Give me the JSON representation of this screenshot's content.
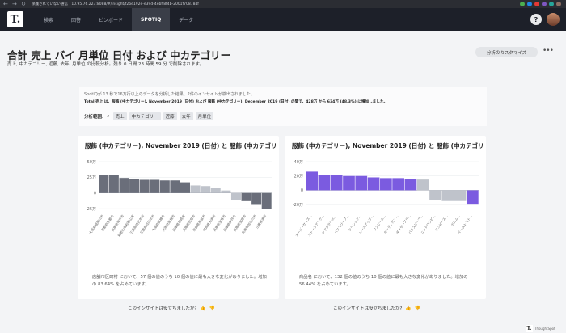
{
  "browser": {
    "warning": "保護されていない通信",
    "url": "10.95.76.223:8088/#/insight/f2be192e-e39d-4ebf-8f4b-2001f708784f"
  },
  "appbar": {
    "logo": "T.",
    "tabs": [
      {
        "label": "検索",
        "active": false
      },
      {
        "label": "回答",
        "active": false
      },
      {
        "label": "ピンボード",
        "active": false
      },
      {
        "label": "SPOTIQ",
        "active": true
      },
      {
        "label": "データ",
        "active": false
      }
    ],
    "help": "?"
  },
  "header": {
    "title": "合計 売上 バイ 月単位 日付 および 中カテゴリー",
    "subtitle": "売上, 中カテゴリー, 近藤, 去年, 月単位 の比較分析。残り 0 日間 23 時間 59 分 で削除されます。",
    "customize_label": "分析のカスタマイズ",
    "more": "•••"
  },
  "insight": {
    "line1": "SpotIQが 13 秒で16万行以上のデータを分析した結果、2件のインサイトが検出されました。",
    "line2": "Total 売上 は、服飾 (中カテゴリー), November 2019 (日付) および 服飾 (中カテゴリー), December 2019 (日付) の間で、428万 から 634万 (48.3%) に増加しました。",
    "scope_label": "分析範囲:",
    "chips": [
      "売上",
      "中カテゴリー",
      "近藤",
      "去年",
      "月単位"
    ]
  },
  "cards": [
    {
      "title": "服飾 (中カテゴリー), November 2019 (日付) と 服飾 (中カテゴリー), December 2019 (日付)",
      "description": "店舗市区町村 において、57 個の値のうち 10 個の値に最も大きな変化がありました。増加の 83.64% を占めています。",
      "feedback": "このインサイトは役立ちましたか?"
    },
    {
      "title": "服飾 (中カテゴリー), November 2019 (日付) と 服飾 (中カテゴリー), December 2019 (日付)",
      "description": "商品名 において、132 個の値のうち 10 個の値に最も大きな変化がありました。増加の 56.44% を占めています。",
      "feedback": "このインサイトは役立ちましたか?"
    }
  ],
  "chart_data": [
    {
      "type": "bar",
      "ylim": [
        -30,
        50
      ],
      "ticks": [
        {
          "v": 50,
          "label": "50万"
        },
        {
          "v": 25,
          "label": "25万"
        },
        {
          "v": 0,
          "label": "0"
        },
        {
          "v": -25,
          "label": "-25万"
        }
      ],
      "categories": [
        "大阪府寝屋川市",
        "京都府京都市",
        "兵庫県神戸市",
        "和歌山県和歌山市",
        "三重県四日市市",
        "三重県四日市市",
        "大阪府高槻市",
        "大阪府高槻市",
        "兵庫県尼崎市",
        "兵庫県西宮市",
        "奈良県奈良市",
        "滋賀県大津市",
        "兵庫県宝塚市",
        "兵庫県伊丹市",
        "兵庫県宝塚市",
        "兵庫県加古川市",
        "三重県津市"
      ],
      "values": [
        29,
        29,
        24,
        22,
        21,
        21,
        20,
        20,
        17,
        12,
        11,
        8,
        4,
        -11,
        -13,
        -19,
        -25
      ],
      "colors": [
        "#6a6e7a",
        "#6a6e7a",
        "#6a6e7a",
        "#6a6e7a",
        "#6a6e7a",
        "#6a6e7a",
        "#6a6e7a",
        "#6a6e7a",
        "#6a6e7a",
        "#bfc3cb",
        "#bfc3cb",
        "#bfc3cb",
        "#bfc3cb",
        "#bfc3cb",
        "#6a6e7a",
        "#6a6e7a",
        "#6a6e7a"
      ]
    },
    {
      "type": "bar",
      "ylim": [
        -30,
        40
      ],
      "ticks": [
        {
          "v": 40,
          "label": "40万"
        },
        {
          "v": 20,
          "label": "20万"
        },
        {
          "v": 0,
          "label": "0"
        },
        {
          "v": -20,
          "label": "-20万"
        }
      ],
      "categories": [
        "オーバーサイズ…",
        "ストーンアンク…",
        "シアブラウス…",
        "パフスリーブ…",
        "クラシック…",
        "レースアップ…",
        "ワンピース…",
        "カーディガン…",
        "ギャザーブラ…",
        "パフスリーブ…",
        "ニットワンピ…",
        "ワンピース…",
        "デニム…",
        "イーストスト…"
      ],
      "values": [
        26,
        21,
        21,
        20,
        20,
        18,
        17,
        17,
        16,
        15,
        -14,
        -15,
        -15,
        -20
      ],
      "colors": [
        "#7b5be0",
        "#7b5be0",
        "#7b5be0",
        "#7b5be0",
        "#7b5be0",
        "#7b5be0",
        "#7b5be0",
        "#7b5be0",
        "#7b5be0",
        "#bfc3cb",
        "#bfc3cb",
        "#bfc3cb",
        "#bfc3cb",
        "#7b5be0"
      ]
    }
  ]
}
